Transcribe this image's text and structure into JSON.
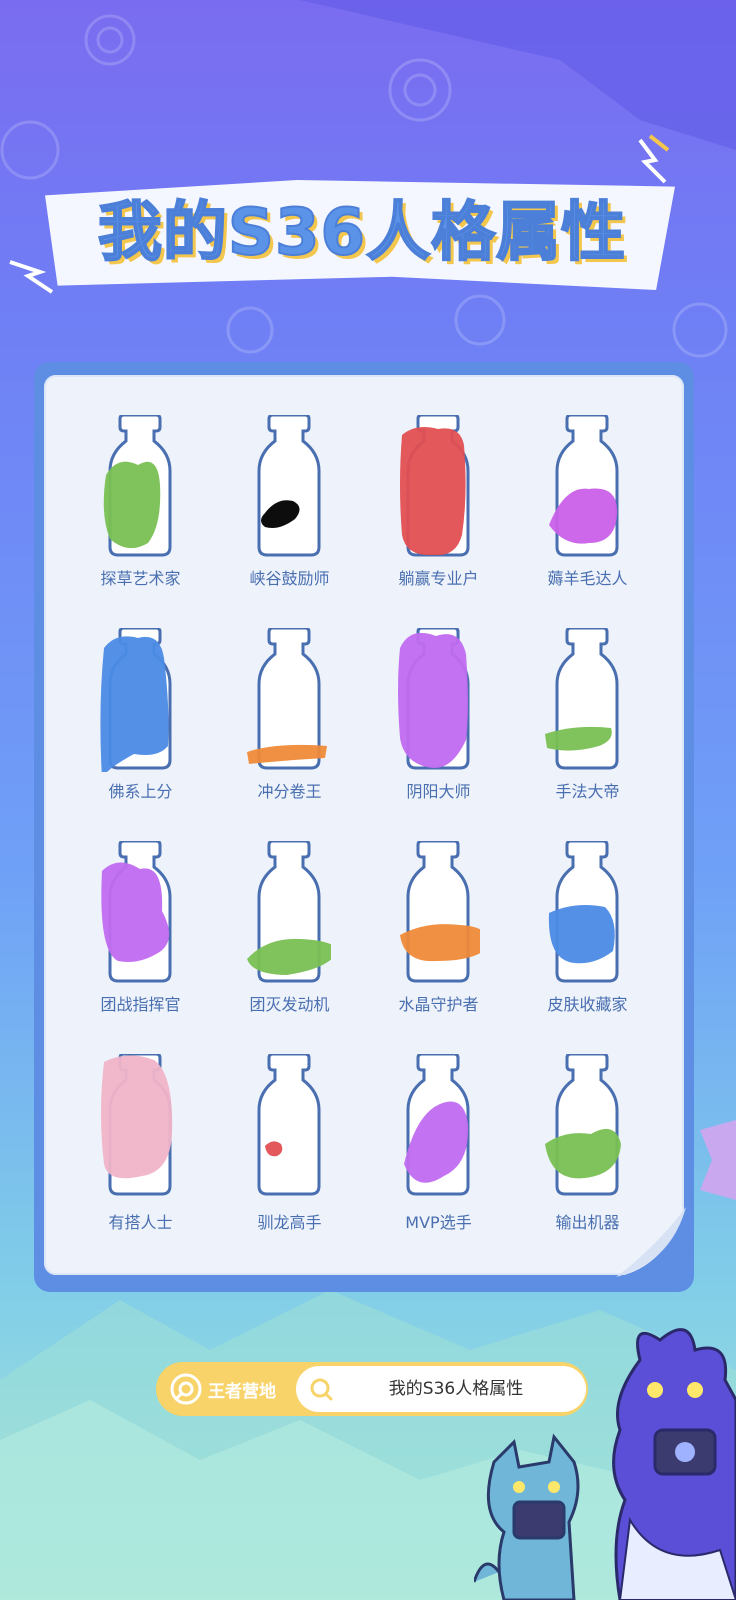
{
  "page": {
    "title": "我的S36人格属性"
  },
  "bottles": [
    {
      "label": "探草艺术家",
      "fill_color": "#79c053"
    },
    {
      "label": "峡谷鼓励师",
      "fill_color": "#000000"
    },
    {
      "label": "躺赢专业户",
      "fill_color": "#e04f52"
    },
    {
      "label": "薅羊毛达人",
      "fill_color": "#c960e8"
    },
    {
      "label": "佛系上分",
      "fill_color": "#4b8be5"
    },
    {
      "label": "冲分卷王",
      "fill_color": "#ee8a38"
    },
    {
      "label": "阴阳大师",
      "fill_color": "#c06cf0"
    },
    {
      "label": "手法大帝",
      "fill_color": "#79c053"
    },
    {
      "label": "团战指挥官",
      "fill_color": "#c06cf0"
    },
    {
      "label": "团灭发动机",
      "fill_color": "#79c053"
    },
    {
      "label": "水晶守护者",
      "fill_color": "#ee8a38"
    },
    {
      "label": "皮肤收藏家",
      "fill_color": "#4b8be5"
    },
    {
      "label": "有搭人士",
      "fill_color": "#f0b4c8"
    },
    {
      "label": "驯龙高手",
      "fill_color": "#e04f52"
    },
    {
      "label": "MVP选手",
      "fill_color": "#c06cf0"
    },
    {
      "label": "输出机器",
      "fill_color": "#79c053"
    }
  ],
  "footer": {
    "brand_name": "王者营地",
    "search_text": "我的S36人格属性",
    "search_icon": "search-icon",
    "brand_icon": "camp-logo-icon"
  },
  "colors": {
    "bottle_outline": "#4a6fb0",
    "title_blue": "#5b93e8",
    "title_shadow": "#f3c64e",
    "pill_yellow": "#f7d36a"
  }
}
